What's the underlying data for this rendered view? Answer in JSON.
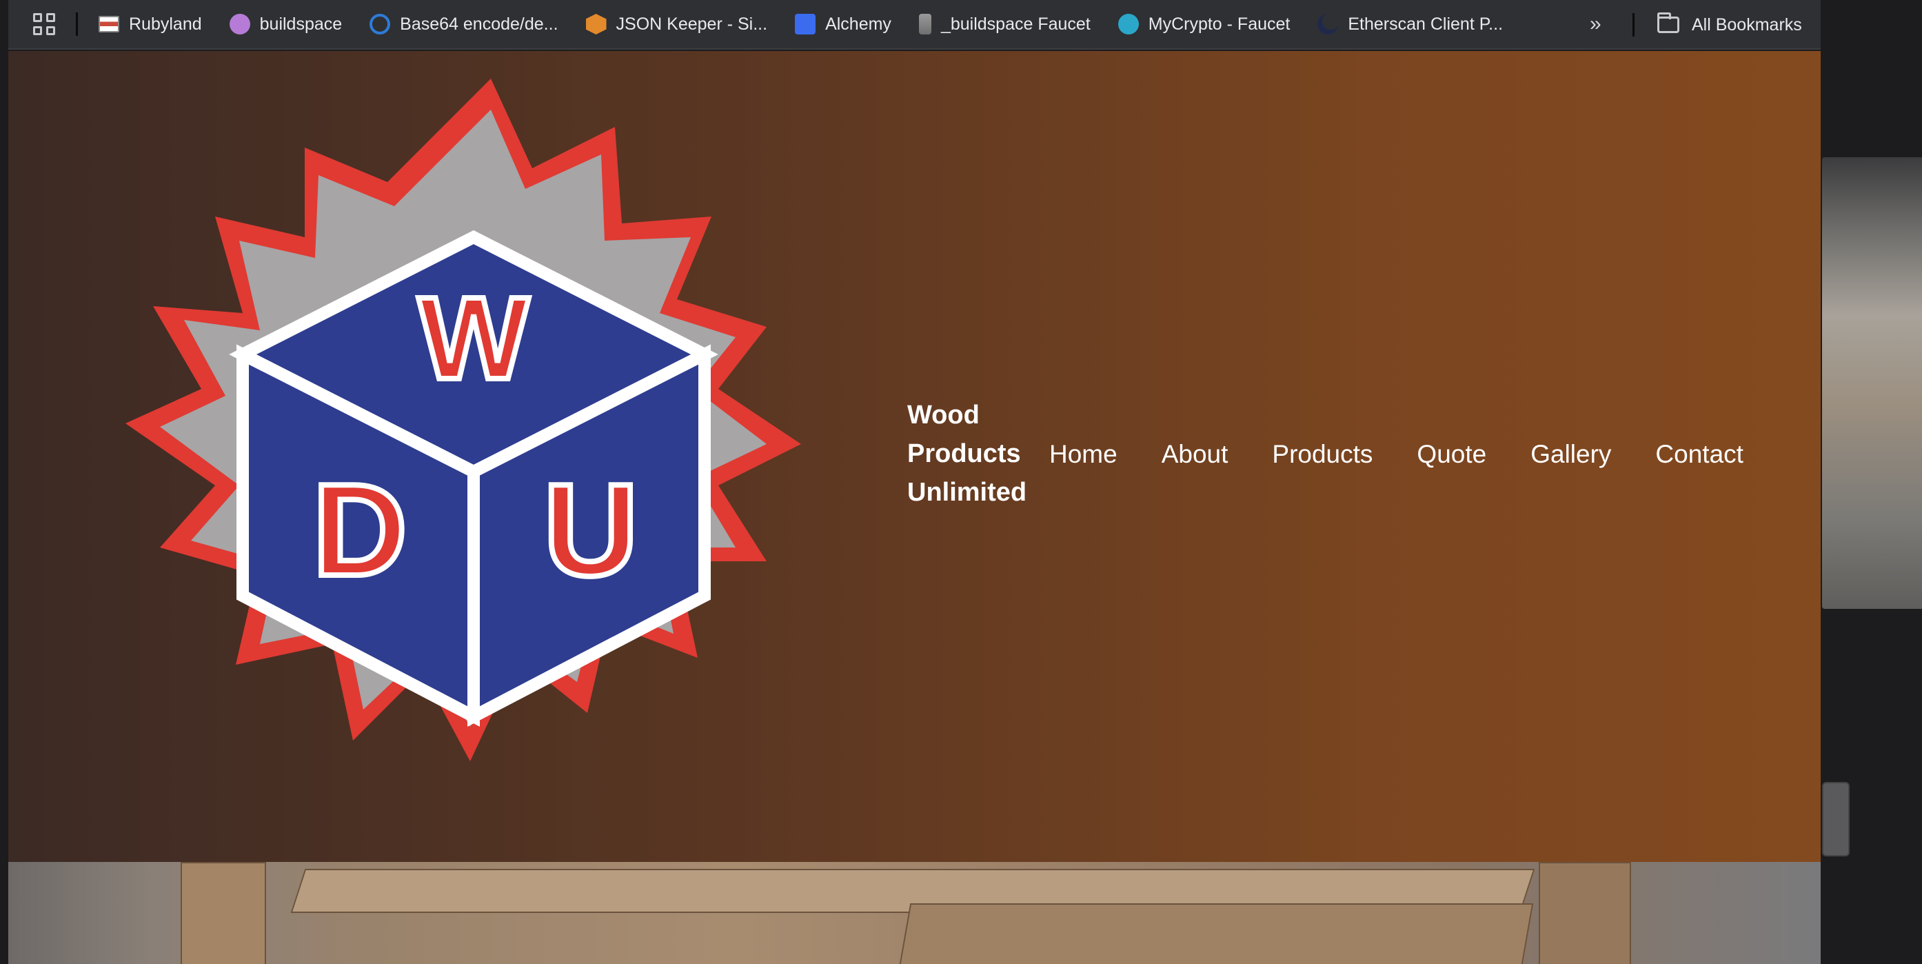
{
  "bookmarks": {
    "items": [
      {
        "label": "Rubyland",
        "icon": "flag-icon",
        "color": "#c94a3b"
      },
      {
        "label": "buildspace",
        "icon": "unicorn-icon",
        "color": "#b57bd6"
      },
      {
        "label": "Base64 encode/de...",
        "icon": "gear-icon",
        "color": "#2e7bd8"
      },
      {
        "label": "JSON Keeper - Si...",
        "icon": "box-icon",
        "color": "#e38a2c"
      },
      {
        "label": "Alchemy",
        "icon": "alchemy-icon",
        "color": "#3b6cf0"
      },
      {
        "label": "_buildspace Faucet",
        "icon": "faucet-icon",
        "color": "#9a9a9a"
      },
      {
        "label": "MyCrypto - Faucet",
        "icon": "mycrypto-icon",
        "color": "#2aa7c9"
      },
      {
        "label": "Etherscan Client P...",
        "icon": "moon-icon",
        "color": "#20294a"
      }
    ],
    "more": "»",
    "all_bookmarks": "All Bookmarks"
  },
  "site": {
    "brand_lines": [
      "Wood",
      "Products",
      "Unlimited"
    ],
    "nav": [
      "Home",
      "About",
      "Products",
      "Quote",
      "Gallery",
      "Contact"
    ],
    "logo_letters": [
      "W",
      "D",
      "U"
    ],
    "colors": {
      "saw_red": "#e03a33",
      "saw_gray": "#a7a5a6",
      "cube_blue": "#2e3d8f"
    }
  }
}
